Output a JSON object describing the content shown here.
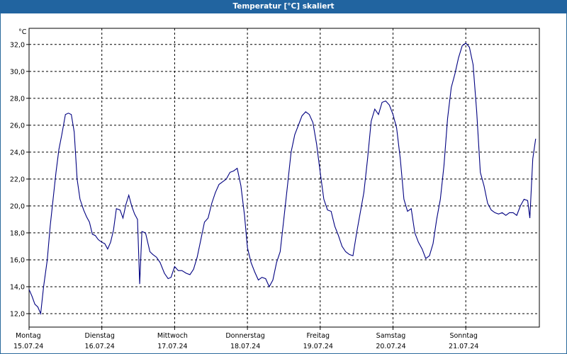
{
  "window": {
    "title": "Temperatur [°C] skaliert"
  },
  "colors": {
    "title_bar": "#2164a0",
    "line": "#000080",
    "grid": "#000000"
  },
  "chart_data": {
    "type": "line",
    "title": "Temperatur [°C] skaliert",
    "unit_label": "°C",
    "ylim": [
      11.0,
      33.2
    ],
    "ytick_step": 2,
    "xlim": [
      0,
      7.0
    ],
    "grid": true,
    "grid_style": "dashed",
    "x_ticks": [
      {
        "x": 0,
        "day": "Montag",
        "date": "15.07.24"
      },
      {
        "x": 1,
        "day": "Dienstag",
        "date": "16.07.24"
      },
      {
        "x": 2,
        "day": "Mittwoch",
        "date": "17.07.24"
      },
      {
        "x": 3,
        "day": "Donnerstag",
        "date": "18.07.24"
      },
      {
        "x": 4,
        "day": "Freitag",
        "date": "19.07.24"
      },
      {
        "x": 5,
        "day": "Samstag",
        "date": "20.07.24"
      },
      {
        "x": 6,
        "day": "Sonntag",
        "date": "21.07.24"
      }
    ],
    "y_ticks": [
      "12,0",
      "14,0",
      "16,0",
      "18,0",
      "20,0",
      "22,0",
      "24,0",
      "26,0",
      "28,0",
      "30,0",
      "32,0"
    ],
    "series": [
      {
        "points": [
          [
            0.0,
            13.8
          ],
          [
            0.04,
            13.3
          ],
          [
            0.08,
            12.7
          ],
          [
            0.12,
            12.5
          ],
          [
            0.16,
            12.0
          ],
          [
            0.2,
            14.0
          ],
          [
            0.25,
            16.0
          ],
          [
            0.29,
            18.5
          ],
          [
            0.33,
            20.5
          ],
          [
            0.37,
            22.5
          ],
          [
            0.41,
            24.2
          ],
          [
            0.45,
            25.3
          ],
          [
            0.5,
            26.8
          ],
          [
            0.54,
            26.9
          ],
          [
            0.58,
            26.8
          ],
          [
            0.62,
            25.5
          ],
          [
            0.66,
            22.0
          ],
          [
            0.7,
            20.5
          ],
          [
            0.75,
            19.7
          ],
          [
            0.79,
            19.2
          ],
          [
            0.83,
            18.8
          ],
          [
            0.87,
            17.9
          ],
          [
            0.91,
            17.8
          ],
          [
            0.95,
            17.5
          ],
          [
            1.0,
            17.3
          ],
          [
            1.04,
            17.2
          ],
          [
            1.08,
            16.8
          ],
          [
            1.12,
            17.3
          ],
          [
            1.16,
            18.2
          ],
          [
            1.2,
            19.8
          ],
          [
            1.25,
            19.7
          ],
          [
            1.29,
            19.1
          ],
          [
            1.33,
            20.1
          ],
          [
            1.37,
            20.8
          ],
          [
            1.41,
            20.0
          ],
          [
            1.45,
            19.4
          ],
          [
            1.49,
            19.0
          ],
          [
            1.52,
            14.2
          ],
          [
            1.55,
            18.1
          ],
          [
            1.6,
            18.0
          ],
          [
            1.66,
            16.6
          ],
          [
            1.7,
            16.4
          ],
          [
            1.75,
            16.2
          ],
          [
            1.8,
            15.8
          ],
          [
            1.86,
            15.0
          ],
          [
            1.91,
            14.6
          ],
          [
            1.95,
            14.7
          ],
          [
            2.0,
            15.5
          ],
          [
            2.05,
            15.2
          ],
          [
            2.1,
            15.2
          ],
          [
            2.16,
            15.0
          ],
          [
            2.21,
            14.9
          ],
          [
            2.26,
            15.3
          ],
          [
            2.31,
            16.2
          ],
          [
            2.36,
            17.5
          ],
          [
            2.41,
            18.8
          ],
          [
            2.46,
            19.1
          ],
          [
            2.51,
            20.2
          ],
          [
            2.56,
            21.0
          ],
          [
            2.61,
            21.6
          ],
          [
            2.66,
            21.8
          ],
          [
            2.71,
            22.0
          ],
          [
            2.76,
            22.5
          ],
          [
            2.81,
            22.6
          ],
          [
            2.86,
            22.8
          ],
          [
            2.91,
            21.5
          ],
          [
            2.96,
            19.3
          ],
          [
            3.0,
            16.9
          ],
          [
            3.05,
            15.8
          ],
          [
            3.1,
            15.1
          ],
          [
            3.15,
            14.5
          ],
          [
            3.2,
            14.7
          ],
          [
            3.25,
            14.6
          ],
          [
            3.3,
            14.0
          ],
          [
            3.35,
            14.5
          ],
          [
            3.4,
            15.8
          ],
          [
            3.45,
            16.6
          ],
          [
            3.5,
            19.0
          ],
          [
            3.55,
            21.5
          ],
          [
            3.6,
            24.0
          ],
          [
            3.65,
            25.3
          ],
          [
            3.7,
            26.0
          ],
          [
            3.75,
            26.7
          ],
          [
            3.8,
            27.0
          ],
          [
            3.85,
            26.8
          ],
          [
            3.9,
            26.2
          ],
          [
            3.95,
            24.6
          ],
          [
            4.0,
            22.5
          ],
          [
            4.05,
            20.5
          ],
          [
            4.1,
            19.7
          ],
          [
            4.15,
            19.6
          ],
          [
            4.2,
            18.5
          ],
          [
            4.25,
            17.8
          ],
          [
            4.3,
            17.0
          ],
          [
            4.35,
            16.6
          ],
          [
            4.4,
            16.4
          ],
          [
            4.45,
            16.3
          ],
          [
            4.5,
            18.0
          ],
          [
            4.55,
            19.5
          ],
          [
            4.6,
            21.0
          ],
          [
            4.65,
            23.5
          ],
          [
            4.7,
            26.3
          ],
          [
            4.75,
            27.2
          ],
          [
            4.8,
            26.8
          ],
          [
            4.85,
            27.7
          ],
          [
            4.9,
            27.8
          ],
          [
            4.95,
            27.5
          ],
          [
            5.0,
            26.8
          ],
          [
            5.05,
            25.8
          ],
          [
            5.1,
            23.5
          ],
          [
            5.15,
            20.5
          ],
          [
            5.2,
            19.6
          ],
          [
            5.25,
            19.8
          ],
          [
            5.3,
            18.0
          ],
          [
            5.35,
            17.3
          ],
          [
            5.4,
            16.8
          ],
          [
            5.45,
            16.1
          ],
          [
            5.5,
            16.3
          ],
          [
            5.55,
            17.2
          ],
          [
            5.6,
            19.0
          ],
          [
            5.65,
            20.5
          ],
          [
            5.7,
            23.0
          ],
          [
            5.75,
            26.5
          ],
          [
            5.8,
            28.8
          ],
          [
            5.85,
            29.8
          ],
          [
            5.9,
            31.0
          ],
          [
            5.95,
            31.9
          ],
          [
            6.0,
            32.1
          ],
          [
            6.05,
            31.8
          ],
          [
            6.1,
            30.5
          ],
          [
            6.15,
            27.0
          ],
          [
            6.2,
            22.5
          ],
          [
            6.25,
            21.5
          ],
          [
            6.3,
            20.2
          ],
          [
            6.35,
            19.7
          ],
          [
            6.4,
            19.5
          ],
          [
            6.45,
            19.4
          ],
          [
            6.5,
            19.5
          ],
          [
            6.55,
            19.3
          ],
          [
            6.6,
            19.5
          ],
          [
            6.65,
            19.5
          ],
          [
            6.7,
            19.3
          ],
          [
            6.75,
            20.0
          ],
          [
            6.8,
            20.5
          ],
          [
            6.85,
            20.4
          ],
          [
            6.88,
            19.1
          ],
          [
            6.92,
            23.5
          ],
          [
            6.96,
            25.0
          ],
          [
            7.0,
            24.5
          ]
        ]
      }
    ]
  }
}
